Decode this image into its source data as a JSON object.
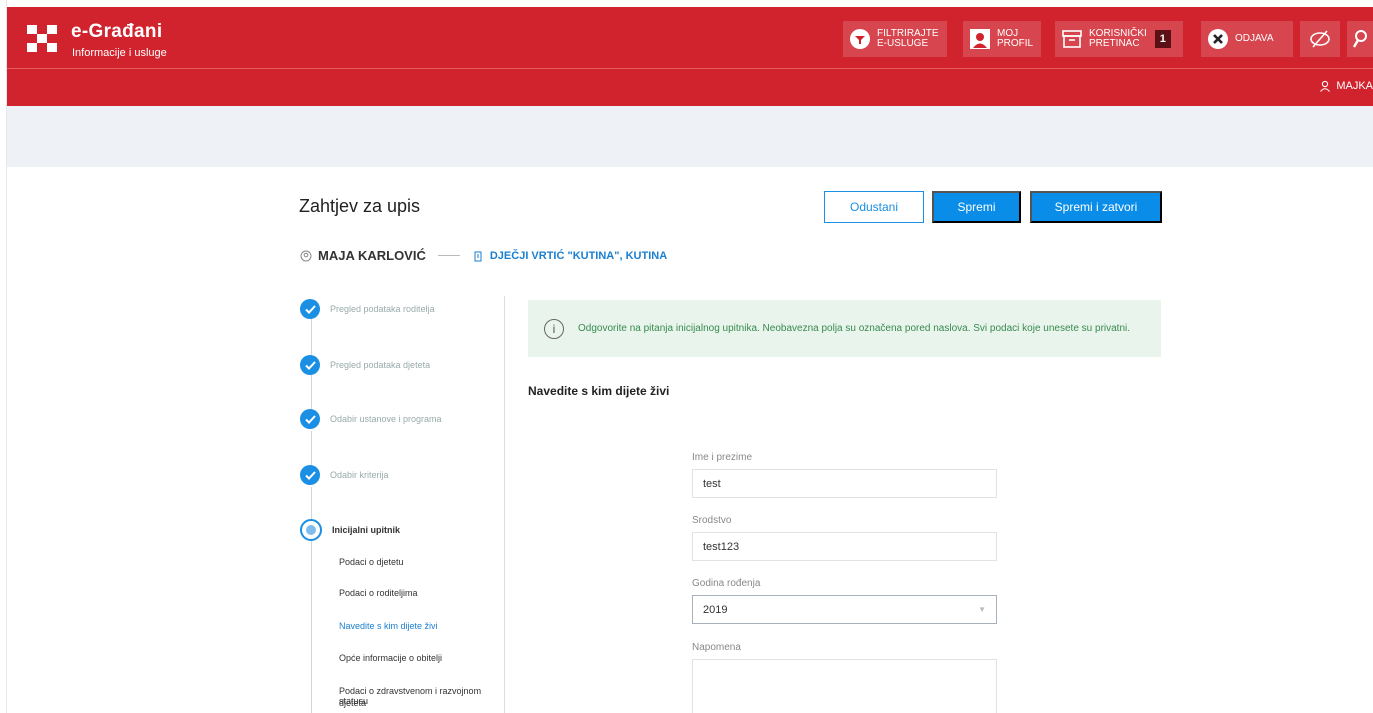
{
  "brand": {
    "title": "e-Građani",
    "subtitle": "Informacije i usluge"
  },
  "header_buttons": [
    {
      "label1": "FILTRIRAJTE",
      "label2": "E-USLUGE"
    },
    {
      "label1": "MOJ",
      "label2": "PROFIL"
    },
    {
      "label1": "KORISNIČKI",
      "label2": "PRETINAC",
      "badge": "1"
    },
    {
      "label1": "ODJAVA"
    }
  ],
  "user_link": "MAJKA",
  "page": {
    "title": "Zahtjev za upis",
    "cancel_label": "Odustani",
    "save_label": "Spremi",
    "save_close_label": "Spremi i zatvori"
  },
  "crumbs": {
    "person": "MAJA KARLOVIĆ",
    "institution": "DJEČJI VRTIĆ \"KUTINA\", KUTINA"
  },
  "steps": [
    {
      "label": "Pregled podataka roditelja"
    },
    {
      "label": "Pregled podataka djeteta"
    },
    {
      "label": "Odabir ustanove i programa"
    },
    {
      "label": "Odabir kriterija"
    },
    {
      "label": "Inicijalni upitnik"
    }
  ],
  "substeps": [
    {
      "label": "Podaci o djetetu"
    },
    {
      "label": "Podaci o roditeljima"
    },
    {
      "label": "Navedite s kim dijete živi"
    },
    {
      "label": "Opće informacije o obitelji"
    },
    {
      "label": "Podaci o zdravstvenom i razvojnom statusu"
    },
    {
      "label": "djeteta"
    }
  ],
  "info": {
    "text": "Odgovorite na pitanja inicijalnog upitnika. Neobavezna polja su označena pored naslova. Svi podaci koje unesete su privatni."
  },
  "section": {
    "title": "Navedite s kim dijete živi"
  },
  "form": {
    "name_label": "Ime i prezime",
    "name_value": "test",
    "relation_label": "Srodstvo",
    "relation_value": "test123",
    "year_label": "Godina rođenja",
    "year_value": "2019",
    "note_label": "Napomena"
  },
  "colors": {
    "header": "#d0232d",
    "accent": "#0a8de8",
    "info_bg": "#e8f4ec"
  }
}
